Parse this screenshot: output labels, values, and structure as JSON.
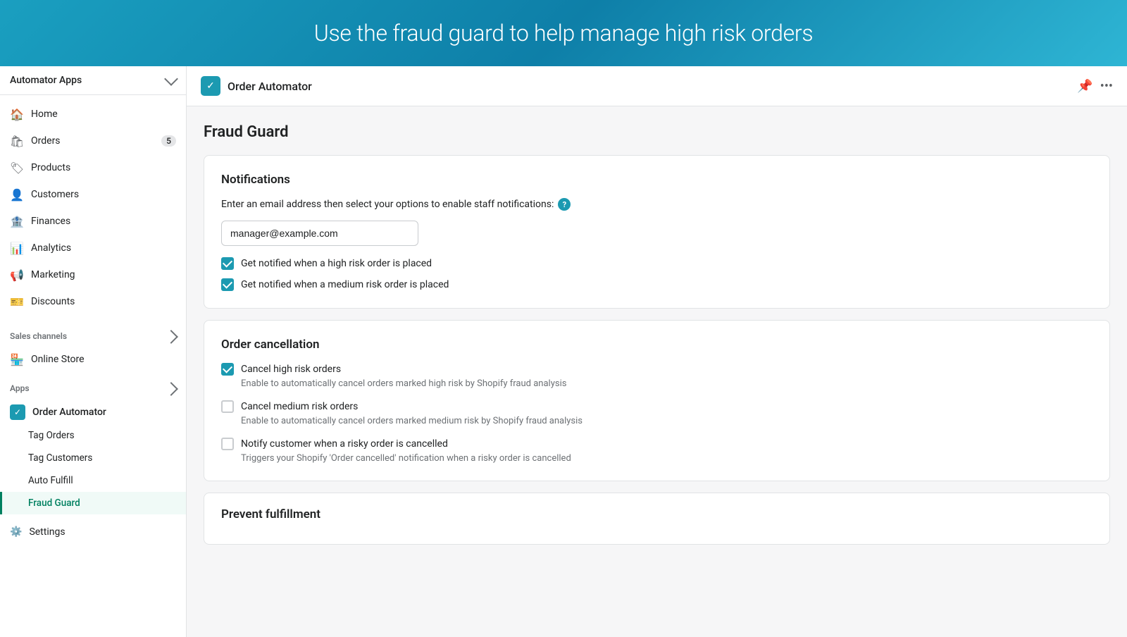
{
  "banner": {
    "text": "Use the fraud guard to help manage high risk orders"
  },
  "sidebar": {
    "app_selector": "Automator Apps",
    "nav_items": [
      {
        "id": "home",
        "label": "Home",
        "icon": "🏠",
        "badge": null
      },
      {
        "id": "orders",
        "label": "Orders",
        "icon": "📋",
        "badge": "5"
      },
      {
        "id": "products",
        "label": "Products",
        "icon": "🏷️",
        "badge": null
      },
      {
        "id": "customers",
        "label": "Customers",
        "icon": "👤",
        "badge": null
      },
      {
        "id": "finances",
        "label": "Finances",
        "icon": "🏦",
        "badge": null
      },
      {
        "id": "analytics",
        "label": "Analytics",
        "icon": "📊",
        "badge": null
      },
      {
        "id": "marketing",
        "label": "Marketing",
        "icon": "📢",
        "badge": null
      },
      {
        "id": "discounts",
        "label": "Discounts",
        "icon": "🎫",
        "badge": null
      }
    ],
    "sales_channels_label": "Sales channels",
    "sales_channels": [
      {
        "id": "online-store",
        "label": "Online Store",
        "icon": "🏪"
      }
    ],
    "apps_label": "Apps",
    "apps_main": {
      "label": "Order Automator",
      "icon": "✓"
    },
    "sub_nav": [
      {
        "id": "tag-orders",
        "label": "Tag Orders",
        "active": false
      },
      {
        "id": "tag-customers",
        "label": "Tag Customers",
        "active": false
      },
      {
        "id": "auto-fulfill",
        "label": "Auto Fulfill",
        "active": false
      },
      {
        "id": "fraud-guard",
        "label": "Fraud Guard",
        "active": true
      }
    ],
    "settings": {
      "label": "Settings",
      "icon": "⚙️"
    }
  },
  "header": {
    "icon": "✓",
    "title": "Order Automator",
    "pin_title": "Pin",
    "more_title": "More actions"
  },
  "page": {
    "title": "Fraud Guard",
    "notifications_card": {
      "title": "Notifications",
      "description": "Enter an email address then select your options to enable staff notifications:",
      "email_placeholder": "manager@example.com",
      "email_value": "manager@example.com",
      "checkboxes": [
        {
          "id": "high-risk-notify",
          "label": "Get notified when a high risk order is placed",
          "checked": true
        },
        {
          "id": "medium-risk-notify",
          "label": "Get notified when a medium risk order is placed",
          "checked": true
        }
      ]
    },
    "order_cancellation_card": {
      "title": "Order cancellation",
      "items": [
        {
          "id": "cancel-high",
          "label": "Cancel high risk orders",
          "desc": "Enable to automatically cancel orders marked high risk by Shopify fraud analysis",
          "checked": true
        },
        {
          "id": "cancel-medium",
          "label": "Cancel medium risk orders",
          "desc": "Enable to automatically cancel orders marked medium risk by Shopify fraud analysis",
          "checked": false
        },
        {
          "id": "notify-cancel",
          "label": "Notify customer when a risky order is cancelled",
          "desc": "Triggers your Shopify 'Order cancelled' notification when a risky order is cancelled",
          "checked": false
        }
      ]
    },
    "prevent_fulfillment_card": {
      "title": "Prevent fulfillment"
    }
  }
}
